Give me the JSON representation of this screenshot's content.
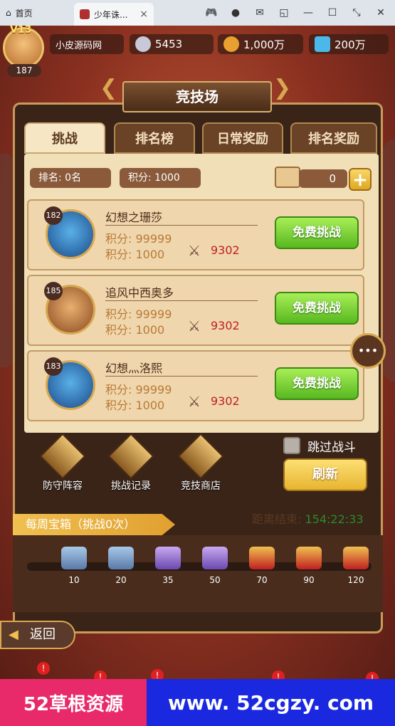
{
  "browser": {
    "home_label": "首页",
    "tab_label": "少年诛...",
    "tab_close": "×"
  },
  "player": {
    "vip": "V13",
    "level": "187",
    "name": "小皮源码网"
  },
  "resources": {
    "attack": "5453",
    "gold": "1,000万",
    "diamonds": "200万"
  },
  "page": {
    "title": "竞技场"
  },
  "tabs": [
    "挑战",
    "排名榜",
    "日常奖励",
    "排名奖励"
  ],
  "stats": {
    "rank": "排名: 0名",
    "points": "积分:  1000",
    "tickets": "0",
    "plus": "+"
  },
  "opponents": [
    {
      "level": "182",
      "name": "幻想之珊莎",
      "score1": "积分: 99999",
      "score2": "积分: 1000",
      "power": "9302",
      "button": "免费挑战"
    },
    {
      "level": "185",
      "name": "追风中西奥多",
      "score1": "积分: 99999",
      "score2": "积分: 1000",
      "power": "9302",
      "button": "免费挑战"
    },
    {
      "level": "183",
      "name": "幻想灬洛熙",
      "score1": "积分: 99999",
      "score2": "积分: 1000",
      "power": "9302",
      "button": "免费挑战"
    }
  ],
  "actions": {
    "skip_battle": "跳过战斗",
    "refresh": "刷新",
    "defense": "防守阵容",
    "records": "挑战记录",
    "shop": "竞技商店"
  },
  "countdown": {
    "label": "距离结束: ",
    "time": "154:22:33"
  },
  "weekly": {
    "label": "每周宝箱（挑战0次）",
    "milestones": [
      "10",
      "20",
      "35",
      "50",
      "70",
      "90",
      "120"
    ],
    "progress": 0
  },
  "back_label": "返回",
  "banner": {
    "left": "52草根资源",
    "right": "www. 52cgzy. com"
  },
  "colors": {
    "free_button": "#7ed23a",
    "refresh_button": "#f2c448",
    "panel_bg": "#f1dfb8"
  }
}
